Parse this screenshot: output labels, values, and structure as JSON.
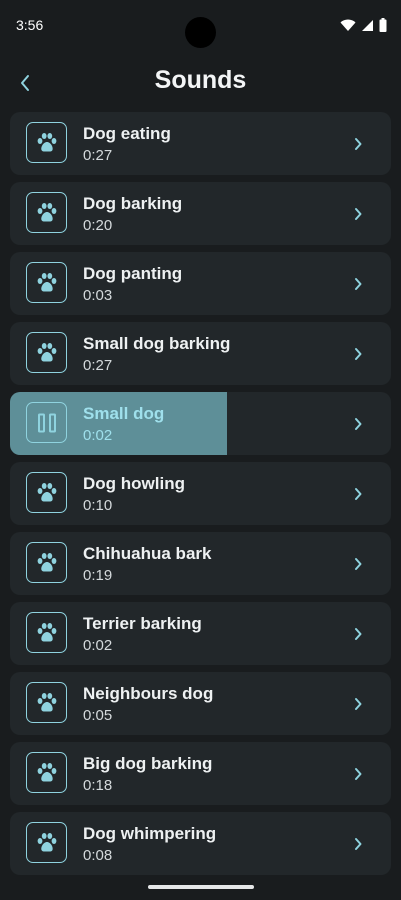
{
  "status": {
    "time": "3:56"
  },
  "header": {
    "title": "Sounds"
  },
  "sounds": [
    {
      "name": "Dog eating",
      "duration": "0:27"
    },
    {
      "name": "Dog barking",
      "duration": "0:20"
    },
    {
      "name": "Dog panting",
      "duration": "0:03"
    },
    {
      "name": "Small dog barking",
      "duration": "0:27"
    },
    {
      "name": "Small dog",
      "duration": "0:02",
      "playing": true,
      "progress": 0.57
    },
    {
      "name": "Dog howling",
      "duration": "0:10"
    },
    {
      "name": "Chihuahua bark",
      "duration": "0:19"
    },
    {
      "name": "Terrier barking",
      "duration": "0:02"
    },
    {
      "name": "Neighbours dog",
      "duration": "0:05"
    },
    {
      "name": "Big dog barking",
      "duration": "0:18"
    },
    {
      "name": "Dog whimpering",
      "duration": "0:08"
    }
  ],
  "icons": {
    "item": "paw-icon",
    "playing": "pause-icon",
    "row_action": "chevron-right-icon",
    "back": "back-arrow-icon"
  },
  "colors": {
    "accent": "#8fd3df",
    "progress": "#5e8f98",
    "card": "#22272a",
    "background": "#191c1e"
  }
}
